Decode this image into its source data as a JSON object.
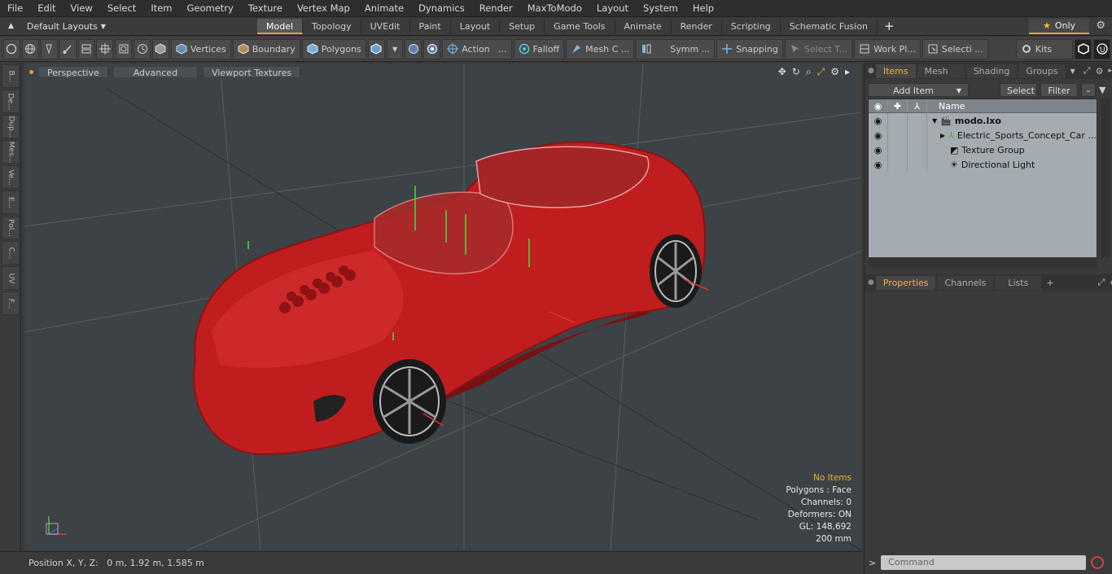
{
  "menu": [
    "File",
    "Edit",
    "View",
    "Select",
    "Item",
    "Geometry",
    "Texture",
    "Vertex Map",
    "Animate",
    "Dynamics",
    "Render",
    "MaxToModo",
    "Layout",
    "System",
    "Help"
  ],
  "layout_selector": "Default Layouts",
  "mode_tabs": [
    {
      "label": "Model",
      "active": true
    },
    {
      "label": "Topology",
      "active": false
    },
    {
      "label": "UVEdit",
      "active": false
    },
    {
      "label": "Paint",
      "active": false
    },
    {
      "label": "Layout",
      "active": false
    },
    {
      "label": "Setup",
      "active": false
    },
    {
      "label": "Game Tools",
      "active": false
    },
    {
      "label": "Animate",
      "active": false
    },
    {
      "label": "Render",
      "active": false
    },
    {
      "label": "Scripting",
      "active": false
    },
    {
      "label": "Schematic Fusion",
      "active": false
    }
  ],
  "only_label": "Only",
  "toolbar": {
    "vertices": "Vertices",
    "boundary": "Boundary",
    "polygons": "Polygons",
    "action": "Action",
    "falloff": "Falloff",
    "mesh": "Mesh C ...",
    "symm": "Symm ...",
    "snapping": "Snapping",
    "select_t": "Select T...",
    "work_plane": "Work Pl...",
    "selecti": "Selecti ...",
    "kits": "Kits"
  },
  "left_tabs": [
    "B...",
    "De...",
    "Dup...",
    "Mes...",
    "Ve...",
    "E...",
    "Pol...",
    "C...",
    "UV",
    "F..."
  ],
  "viewport": {
    "perspective": "Perspective",
    "advanced": "Advanced",
    "textures": "Viewport Textures",
    "info": {
      "no_items": "No Items",
      "polygons": "Polygons : Face",
      "channels": "Channels: 0",
      "deformers": "Deformers: ON",
      "gl": "GL: 148,692",
      "scale": "200 mm"
    }
  },
  "status": {
    "position": "Position X, Y, Z:   0 m, 1.92 m, 1.585 m"
  },
  "items_panel": {
    "tabs": [
      {
        "label": "Items",
        "active": true
      },
      {
        "label": "Mesh ...",
        "active": false
      },
      {
        "label": "Shading",
        "active": false
      },
      {
        "label": "Groups",
        "active": false
      }
    ],
    "add_item": "Add Item",
    "select": "Select",
    "filter": "Filter",
    "col_name": "Name",
    "rows": [
      {
        "name": "modo.lxo",
        "bold": true
      },
      {
        "name": "Electric_Sports_Concept_Car ...",
        "bold": false
      },
      {
        "name": "Texture Group",
        "bold": false
      },
      {
        "name": "Directional Light",
        "bold": false
      }
    ]
  },
  "props_panel": {
    "tabs": [
      {
        "label": "Properties",
        "active": true
      },
      {
        "label": "Channels",
        "active": false
      },
      {
        "label": "Lists",
        "active": false
      }
    ]
  },
  "command_placeholder": "Command",
  "colors": {
    "accent": "#e0a040",
    "car": "#c41e1e",
    "viewport_bg": "#3c4245"
  }
}
